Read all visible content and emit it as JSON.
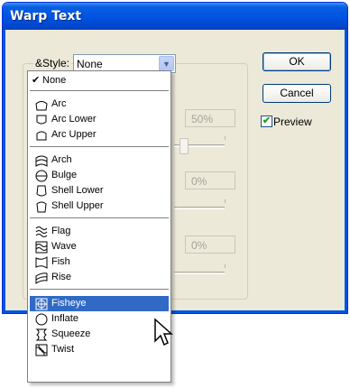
{
  "window": {
    "title": "Warp Text"
  },
  "style_field": {
    "label": "&Style:",
    "value": "None"
  },
  "buttons": {
    "ok": "OK",
    "cancel": "Cancel"
  },
  "preview": {
    "label": "Preview",
    "checked": true
  },
  "disabled_fields": {
    "bend": "50%",
    "horizontal": "0%",
    "vertical": "0%"
  },
  "menu": {
    "none": "None",
    "group1": [
      "Arc",
      "Arc Lower",
      "Arc Upper"
    ],
    "group2": [
      "Arch",
      "Bulge",
      "Shell Lower",
      "Shell Upper"
    ],
    "group3": [
      "Flag",
      "Wave",
      "Fish",
      "Rise"
    ],
    "group4": [
      "Fisheye",
      "Inflate",
      "Squeeze",
      "Twist"
    ],
    "selected": "Fisheye"
  },
  "colors": {
    "title_bar": "#0054e3",
    "selection": "#316ac5",
    "dialog_bg": "#ece9d8"
  }
}
